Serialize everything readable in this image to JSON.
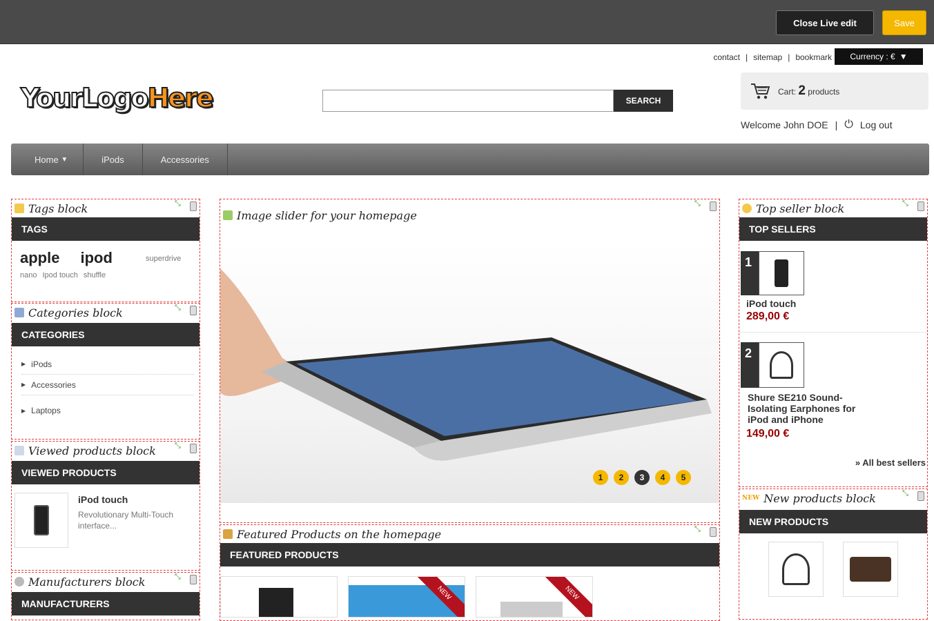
{
  "topbar": {
    "close_label": "Close Live edit",
    "save_label": "Save"
  },
  "header": {
    "links": [
      "contact",
      "sitemap",
      "bookmark"
    ],
    "currency": "Currency : €",
    "logo_part1": "YourLogo",
    "logo_part2": "Here",
    "search_placeholder": "",
    "search_label": "SEARCH",
    "cart_prefix": "Cart:",
    "cart_count": "2",
    "cart_suffix": "products",
    "welcome": "Welcome John DOE",
    "logout": "Log out"
  },
  "nav": {
    "items": [
      "Home",
      "iPods",
      "Accessories"
    ]
  },
  "blocks": {
    "tags": {
      "title": "Tags block",
      "bar": "TAGS",
      "big": [
        "apple",
        "ipod"
      ],
      "small": [
        "superdrive",
        "nano",
        "Ipod touch",
        "shuffle"
      ]
    },
    "categories": {
      "title": "Categories block",
      "bar": "CATEGORIES",
      "items": [
        "iPods",
        "Accessories",
        "Laptops"
      ]
    },
    "viewed": {
      "title": "Viewed products block",
      "bar": "VIEWED PRODUCTS",
      "product_name": "iPod touch",
      "product_desc": "Revolutionary Multi-Touch interface..."
    },
    "manufacturers": {
      "title": "Manufacturers block",
      "bar": "MANUFACTURERS"
    },
    "slider": {
      "title": "Image slider for your homepage",
      "pages": [
        "1",
        "2",
        "3",
        "4",
        "5"
      ],
      "active_page": "3"
    },
    "featured": {
      "title": "Featured Products on the homepage",
      "bar": "FEATURED PRODUCTS",
      "badge": "NEW"
    },
    "topseller": {
      "title": "Top seller block",
      "bar": "TOP SELLERS",
      "items": [
        {
          "rank": "1",
          "name": "iPod touch",
          "price": "289,00 €"
        },
        {
          "rank": "2",
          "name": "Shure SE210 Sound-Isolating Earphones for iPod and iPhone",
          "price": "149,00 €"
        }
      ],
      "all_link": "» All best sellers"
    },
    "newproducts": {
      "title": "New products block",
      "bar": "NEW PRODUCTS",
      "badge": "NEW"
    }
  },
  "colors": {
    "accent": "#f5b800",
    "price": "#990000",
    "edit_border": "#e03c3c",
    "dark_bar": "#333333"
  }
}
